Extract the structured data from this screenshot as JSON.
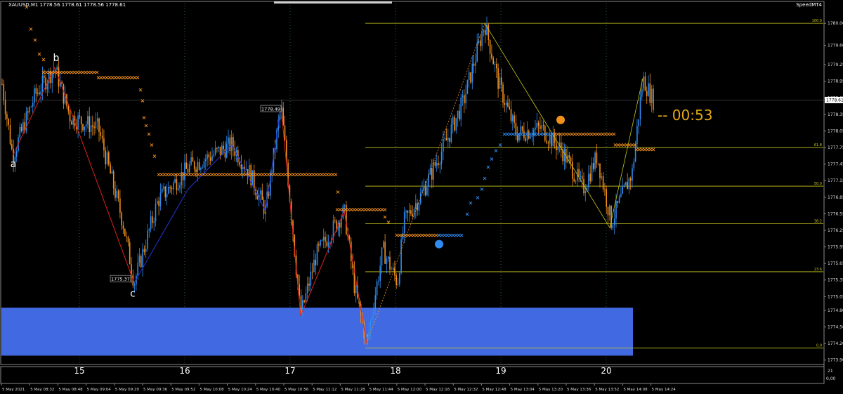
{
  "window": {
    "title": "XAUUSD,M1  1778.56 1778.61 1778.56 1778.61",
    "indicator_label": "SpeedMT4"
  },
  "colors": {
    "bg": "#000000",
    "bull": "#2f8cf2",
    "bear": "#f2901c",
    "fib": "#c8c81e",
    "zone": "#4169e1",
    "zigzag_red": "#e02020",
    "zigzag_blue": "#2436d8",
    "grid": "#2e5a5a"
  },
  "chart_data": {
    "type": "candlestick",
    "title": "XAUUSD,M1",
    "ylim": [
      1773.82,
      1780.32
    ],
    "price_ticks": [
      "1780.00",
      "1779.60",
      "1779.25",
      "1778.95",
      "1778.65",
      "1778.35",
      "1778.05",
      "1777.75",
      "1777.45",
      "1777.15",
      "1776.85",
      "1776.55",
      "1776.25",
      "1775.95",
      "1775.65",
      "1775.35",
      "1775.05",
      "1774.80",
      "1774.50",
      "1774.20",
      "1773.90"
    ],
    "current_price": {
      "label": "1778.61",
      "value": 1778.61
    },
    "x_day_ticks": [
      {
        "label": "15",
        "x": 14.7
      },
      {
        "label": "16",
        "x": 16
      },
      {
        "label": "17",
        "x": 17
      },
      {
        "label": "18",
        "x": 18
      },
      {
        "label": "19",
        "x": 19
      },
      {
        "label": "20",
        "x": 20
      }
    ],
    "x_time_ticks": [
      "5 May 2021",
      "5 May 08:32",
      "5 May 08:48",
      "5 May 09:04",
      "5 May 09:20",
      "5 May 09:36",
      "5 May 09:52",
      "5 May 10:08",
      "5 May 10:24",
      "5 May 10:40",
      "5 May 10:56",
      "5 May 11:12",
      "5 May 11:28",
      "5 May 11:44",
      "5 May 12:00",
      "5 May 12:16",
      "5 May 12:32",
      "5 May 12:48",
      "5 May 13:04",
      "5 May 13:20",
      "5 May 13:36",
      "5 May 13:52",
      "5 May 14:08",
      "5 May 14:24"
    ],
    "fib_levels": [
      {
        "label": "100.0",
        "value": 1780.0
      },
      {
        "label": "61.8",
        "value": 1777.75
      },
      {
        "label": "50.0",
        "value": 1777.05
      },
      {
        "label": "38.2",
        "value": 1776.37
      },
      {
        "label": "23.6",
        "value": 1775.5
      },
      {
        "label": "0.0",
        "value": 1774.12
      }
    ],
    "wave_labels": [
      {
        "label": "a",
        "value": 1777.6
      },
      {
        "label": "b",
        "value": 1779.2
      },
      {
        "label": "c",
        "value": 1775.25
      }
    ],
    "price_flags": [
      {
        "label": "1778.49",
        "value": 1778.45
      },
      {
        "label": "1775.37",
        "value": 1775.37
      }
    ],
    "countdown": "-- 00:53",
    "sub_window": {
      "top_label": "21",
      "bottom_label": "0,00"
    },
    "zone": {
      "top": 1774.85,
      "bottom": 1773.98
    }
  }
}
